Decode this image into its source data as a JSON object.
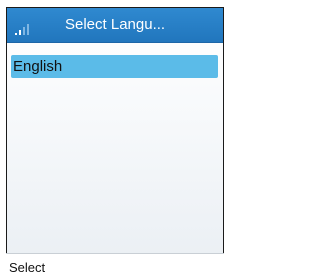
{
  "header": {
    "title": "Select Langu...",
    "signal_icon": "signal-strength-icon"
  },
  "languages": [
    {
      "label": "English",
      "selected": true
    }
  ],
  "softkeys": {
    "left": "Select"
  },
  "colors": {
    "title_bar": "#2176bd",
    "selection": "#5bbbe8"
  }
}
